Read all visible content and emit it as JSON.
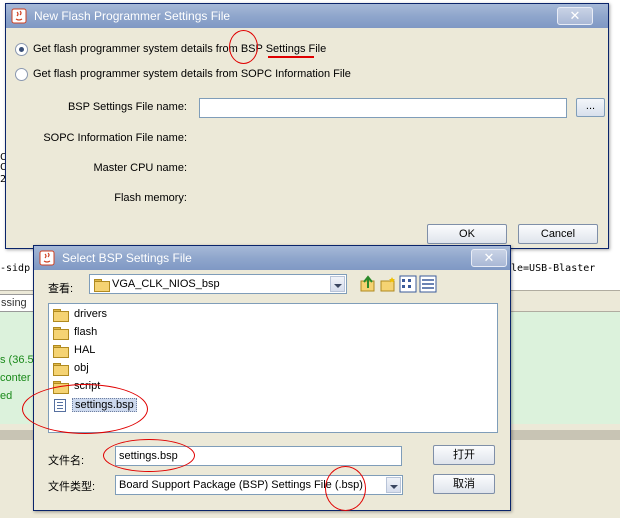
{
  "background": {
    "terminal_lines": [
      {
        "text": "-sidp"
      },
      {
        "text": "le=USB-Blaster"
      }
    ],
    "left_fragments": [
      "C",
      "C",
      "2"
    ],
    "tab_label": "ssing",
    "green_lines": [
      "s (36.5",
      "conter",
      "ed"
    ]
  },
  "flash_dialog": {
    "title": "New Flash Programmer Settings File",
    "close_symbol": "✕",
    "options": [
      {
        "label": "Get flash programmer system details from BSP Settings File",
        "checked": true
      },
      {
        "label": "Get flash programmer system details from SOPC Information File",
        "checked": false
      }
    ],
    "fields": {
      "bsp_label": "BSP Settings File name:",
      "bsp_value": "",
      "browse_label": "...",
      "sopc_label": "SOPC Information File name:",
      "cpu_label": "Master CPU name:",
      "flash_label": "Flash memory:"
    },
    "ok_label": "OK",
    "cancel_label": "Cancel"
  },
  "select_dialog": {
    "title": "Select BSP Settings File",
    "close_symbol": "✕",
    "look_in_label": "查看:",
    "look_in_value": "VGA_CLK_NIOS_bsp",
    "items": [
      {
        "name": "drivers",
        "type": "folder"
      },
      {
        "name": "flash",
        "type": "folder"
      },
      {
        "name": "HAL",
        "type": "folder"
      },
      {
        "name": "obj",
        "type": "folder"
      },
      {
        "name": "script",
        "type": "folder"
      },
      {
        "name": "settings.bsp",
        "type": "file",
        "selected": true
      }
    ],
    "filename_label": "文件名:",
    "filename_value": "settings.bsp",
    "filetype_label": "文件类型:",
    "filetype_value": "Board Support Package (BSP) Settings File (.bsp)",
    "open_label": "打开",
    "cancel_label": "取消"
  },
  "colors": {
    "title_bar": "#8fa6cc",
    "window_bg": "#ece9d8",
    "annotation": "#e00000"
  }
}
